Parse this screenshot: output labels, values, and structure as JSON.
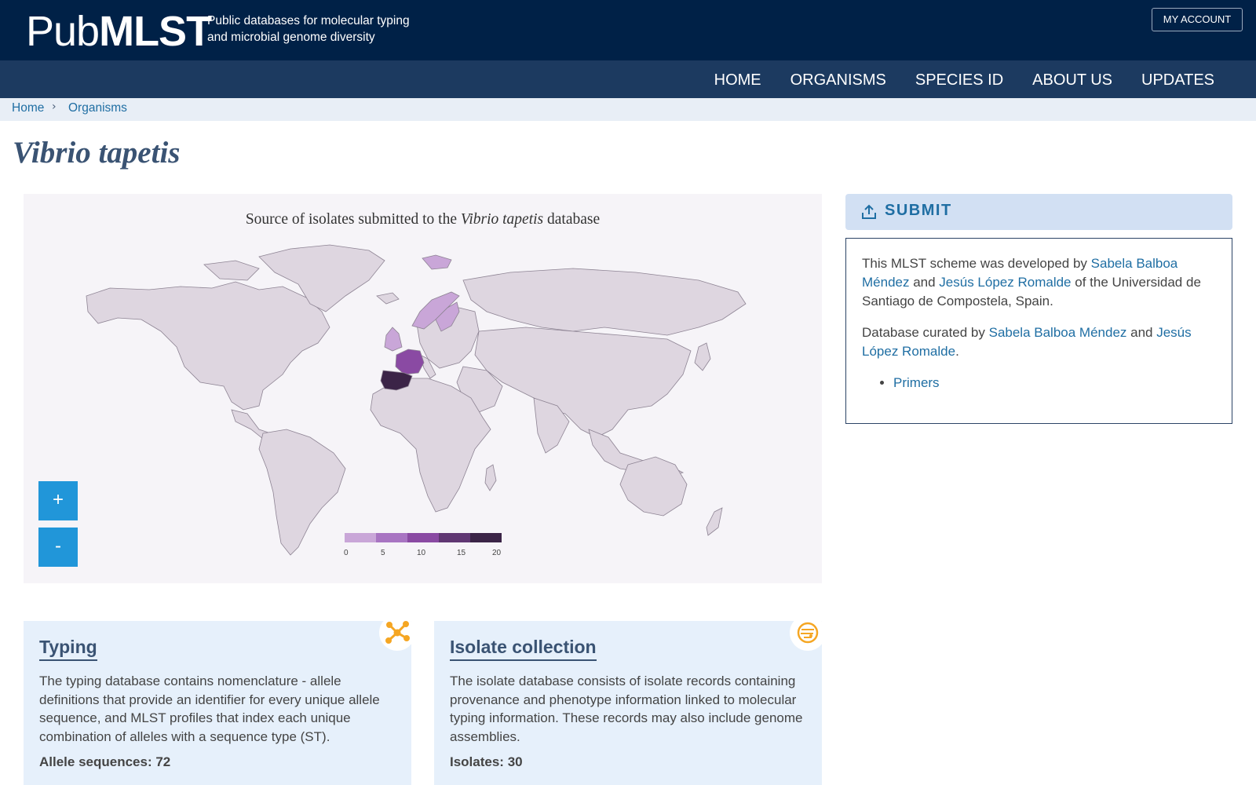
{
  "header": {
    "logo_light": "Pub",
    "logo_bold": "MLST",
    "tagline_line1": "Public databases for molecular typing",
    "tagline_line2": "and microbial genome diversity",
    "account_label": "MY ACCOUNT"
  },
  "nav": {
    "items": [
      {
        "label": "HOME"
      },
      {
        "label": "ORGANISMS"
      },
      {
        "label": "SPECIES ID"
      },
      {
        "label": "ABOUT US"
      },
      {
        "label": "UPDATES"
      }
    ]
  },
  "breadcrumb": {
    "items": [
      {
        "label": "Home"
      },
      {
        "label": "Organisms"
      }
    ]
  },
  "page": {
    "title": "Vibrio tapetis"
  },
  "map": {
    "title_pre": "Source of isolates submitted to the ",
    "title_species": "Vibrio tapetis",
    "title_post": " database",
    "zoom_in": "+",
    "zoom_out": "-",
    "legend_colors": [
      "#c9a6d8",
      "#a874c2",
      "#8a4aa3",
      "#603773",
      "#3b2447"
    ],
    "legend_labels": [
      "0",
      "5",
      "10",
      "15",
      "20"
    ],
    "base_color": "#ded6e0",
    "highlighted_countries": [
      {
        "country": "Spain",
        "bin": 4
      },
      {
        "country": "France",
        "bin": 2
      },
      {
        "country": "United Kingdom",
        "bin": 0
      },
      {
        "country": "Norway",
        "bin": 0
      },
      {
        "country": "Sweden",
        "bin": 0
      },
      {
        "country": "Svalbard",
        "bin": 0
      }
    ]
  },
  "submit": {
    "label": "SUBMIT"
  },
  "info": {
    "p1_pre": "This MLST scheme was developed by ",
    "p1_link1": "Sabela Balboa Méndez",
    "p1_mid": " and ",
    "p1_link2": "Jesús López Romalde",
    "p1_post": " of the Universidad de Santiago de Compostela, Spain.",
    "p2_pre": "Database curated by ",
    "p2_link1": "Sabela Balboa Méndez",
    "p2_mid": " and ",
    "p2_link2": "Jesús López Romalde",
    "p2_post": ".",
    "list": [
      {
        "label": "Primers"
      }
    ]
  },
  "cards": [
    {
      "title": "Typing",
      "text": "The typing database contains nomenclature - allele definitions that provide an identifier for every unique allele sequence, and MLST profiles that index each unique combination of alleles with a sequence type (ST).",
      "stat": "Allele sequences: 72",
      "icon": "typing-network-icon"
    },
    {
      "title": "Isolate collection",
      "text": "The isolate database consists of isolate records containing provenance and phenotype information linked to molecular typing information. These records may also include genome assemblies.",
      "stat": "Isolates: 30",
      "icon": "petri-dish-icon"
    }
  ],
  "colors": {
    "header_bg": "#002147",
    "nav_bg": "#1c3a60",
    "link": "#1f6ea3",
    "accent_orange": "#f5a623",
    "zoom_button": "#2196d9"
  }
}
